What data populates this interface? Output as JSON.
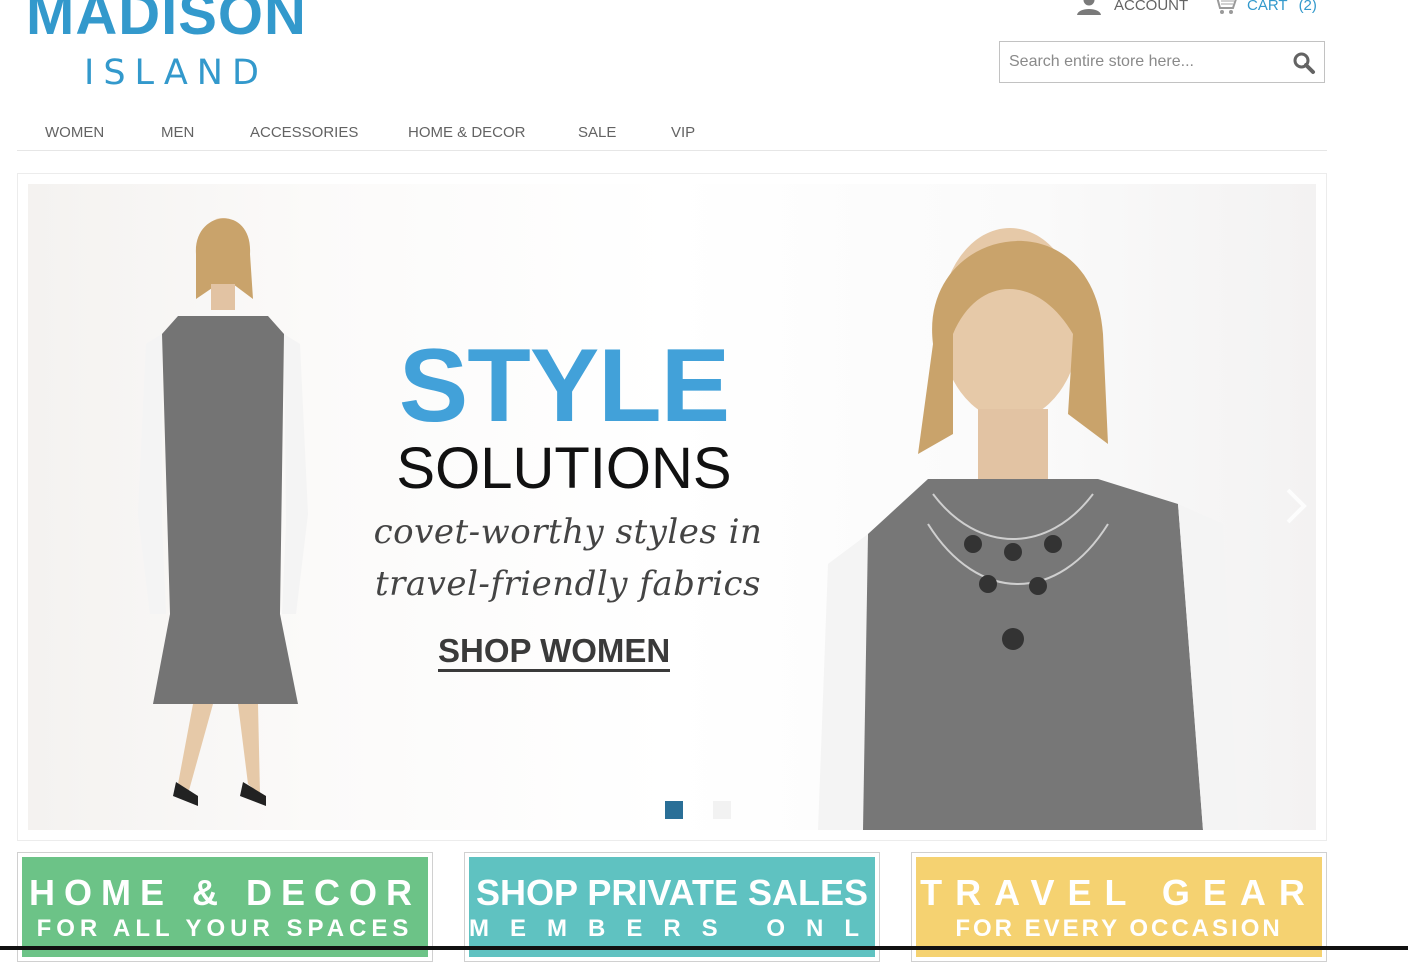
{
  "logo": {
    "main": "MADISON",
    "sub": "ISLAND"
  },
  "header": {
    "account_label": "ACCOUNT",
    "cart_label": "CART",
    "cart_count": "(2)",
    "search_placeholder": "Search entire store here..."
  },
  "nav": [
    "WOMEN",
    "MEN",
    "ACCESSORIES",
    "HOME & DECOR",
    "SALE",
    "VIP"
  ],
  "hero": {
    "title": "STYLE",
    "subtitle": "SOLUTIONS",
    "tagline_line1": "covet-worthy styles in",
    "tagline_line2": "travel-friendly fabrics",
    "cta": "SHOP WOMEN",
    "slide_count": 2,
    "active_slide": 1
  },
  "promos": [
    {
      "title": "HOME & DECOR",
      "subtitle": "FOR ALL YOUR SPACES",
      "color": "#6cc387"
    },
    {
      "title": "SHOP PRIVATE SALES",
      "subtitle": "MEMBERS ONLY",
      "color": "#5fc2c1"
    },
    {
      "title": "TRAVEL GEAR",
      "subtitle": "FOR EVERY OCCASION",
      "color": "#f5d271"
    }
  ],
  "colors": {
    "brand": "#3399cc",
    "hero_title": "#42a1d9",
    "nav_text": "#636363"
  },
  "icons": {
    "account": "user-icon",
    "cart": "cart-icon",
    "search": "search-icon"
  }
}
